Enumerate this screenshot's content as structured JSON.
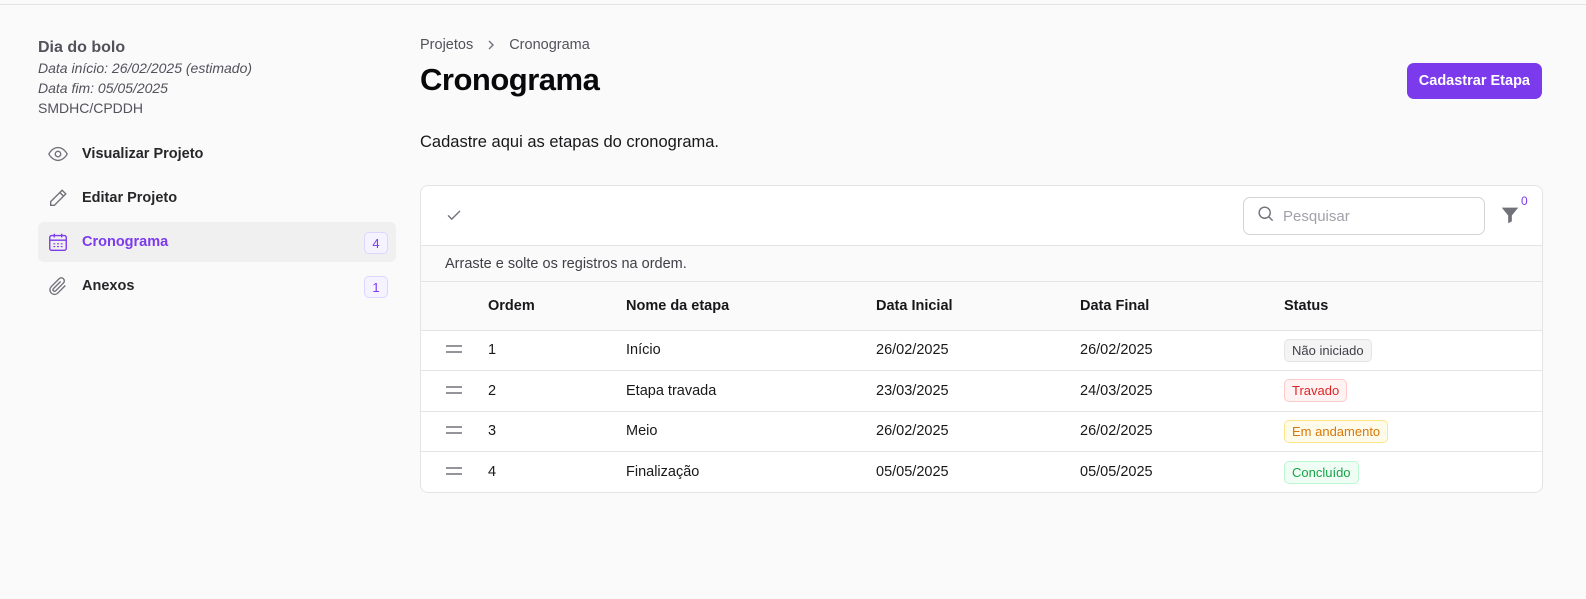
{
  "project": {
    "name": "Dia do bolo",
    "start_date": "Data início: 26/02/2025 (estimado)",
    "end_date": "Data fim: 05/05/2025",
    "org": "SMDHC/CPDDH"
  },
  "sidebar": {
    "items": [
      {
        "label": "Visualizar Projeto",
        "icon": "eye-icon",
        "badge": ""
      },
      {
        "label": "Editar Projeto",
        "icon": "pencil-icon",
        "badge": ""
      },
      {
        "label": "Cronograma",
        "icon": "calendar-icon",
        "badge": "4",
        "active": true
      },
      {
        "label": "Anexos",
        "icon": "paperclip-icon",
        "badge": "1"
      }
    ]
  },
  "breadcrumb": {
    "parent": "Projetos",
    "current": "Cronograma"
  },
  "page": {
    "title": "Cronograma",
    "description": "Cadastre aqui as etapas do cronograma.",
    "primary_button": "Cadastrar Etapa"
  },
  "toolbar": {
    "search_placeholder": "Pesquisar",
    "filter_count": "0"
  },
  "table": {
    "hint": "Arraste e solte os registros na ordem.",
    "columns": [
      "Ordem",
      "Nome da etapa",
      "Data Inicial",
      "Data Final",
      "Status"
    ],
    "rows": [
      {
        "ordem": "1",
        "nome": "Início",
        "inicio": "26/02/2025",
        "fim": "26/02/2025",
        "status": "Não iniciado",
        "status_color": "#3f3f46"
      },
      {
        "ordem": "2",
        "nome": "Etapa travada",
        "inicio": "23/03/2025",
        "fim": "24/03/2025",
        "status": "Travado",
        "status_color": "#dc2626"
      },
      {
        "ordem": "3",
        "nome": "Meio",
        "inicio": "26/02/2025",
        "fim": "26/02/2025",
        "status": "Em andamento",
        "status_color": "#d97706"
      },
      {
        "ordem": "4",
        "nome": "Finalização",
        "inicio": "05/05/2025",
        "fim": "05/05/2025",
        "status": "Concluído",
        "status_color": "#16a34a"
      }
    ]
  },
  "colors": {
    "accent": "#7c3aed"
  }
}
